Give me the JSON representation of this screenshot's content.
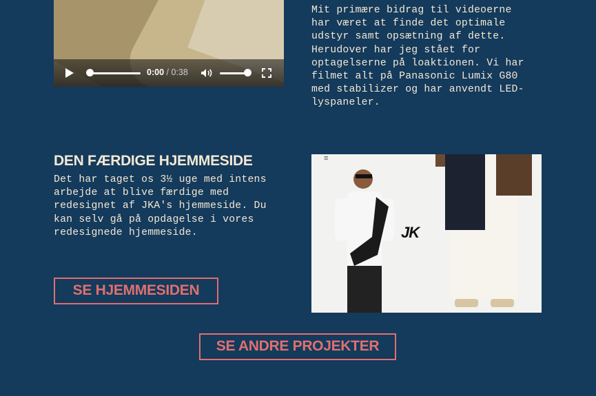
{
  "video": {
    "current_time": "0:00",
    "separator": "/",
    "duration": "0:38",
    "progress": 0,
    "volume": 0.8
  },
  "contribution_text": "Mit primære bidrag til videoerne\nhar været at finde det optimale\nudstyr samt opsætning af dette.\nHerudover har jeg stået for\noptagelserne på loaktionen. Vi har\nfilmet alt på Panasonic Lumix G80\nmed stabilizer og har anvendt LED-\nlyspaneler.",
  "website_section": {
    "title": "DEN FÆRDIGE HJEMMESIDE",
    "text": "Det har taget os 3½ uge med intens\narbejde at blive færdige med\nredesignet af JKA's hjemmeside. Du\nkan selv gå på opdagelse i vores\nredesignede hjemmeside.",
    "button_label": "SE HJEMMESIDEN",
    "preview_logo": "JK",
    "preview_menu_icon": "≡"
  },
  "other_projects_button": "SE ANDRE PROJEKTER",
  "colors": {
    "background": "#143a5c",
    "text": "#f3e9d4",
    "accent": "#e0706f"
  }
}
